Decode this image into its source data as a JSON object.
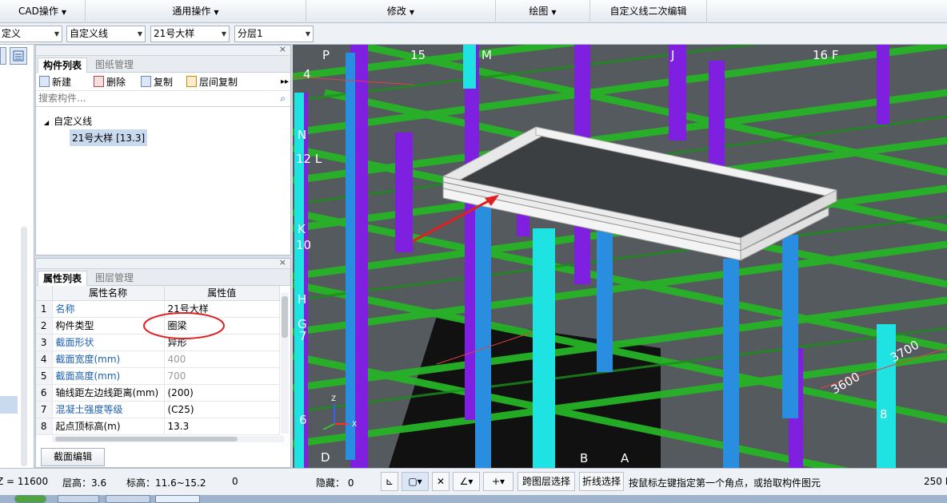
{
  "menubar": {
    "items": [
      {
        "label": "CAD操作",
        "dropdown": true
      },
      {
        "label": "通用操作",
        "dropdown": true
      },
      {
        "label": "修改",
        "dropdown": true
      },
      {
        "label": "绘图",
        "dropdown": true
      },
      {
        "label": "自定义线二次编辑",
        "dropdown": false
      }
    ]
  },
  "toolbar": {
    "combo1": "定义",
    "combo2": "自定义线",
    "combo3": "21号大样",
    "combo4": "分层1"
  },
  "component_panel": {
    "tab_active": "构件列表",
    "tab_inactive": "图纸管理",
    "buttons": {
      "new": "新建",
      "delete": "删除",
      "copy": "复制",
      "floor_copy": "层间复制"
    },
    "search_placeholder": "搜索构件...",
    "tree_root": "自定义线",
    "tree_item": "21号大样 [13.3]"
  },
  "property_panel": {
    "tab_active": "属性列表",
    "tab_inactive": "图层管理",
    "headers": {
      "name": "属性名称",
      "value": "属性值"
    },
    "rows": [
      {
        "num": "1",
        "name": "名称",
        "value": "21号大样"
      },
      {
        "num": "2",
        "name": "构件类型",
        "value": "圈梁"
      },
      {
        "num": "3",
        "name": "截面形状",
        "value": "异形"
      },
      {
        "num": "4",
        "name": "截面宽度(mm)",
        "value": "400"
      },
      {
        "num": "5",
        "name": "截面高度(mm)",
        "value": "700"
      },
      {
        "num": "6",
        "name": "轴线距左边线距离(mm)",
        "value": "(200)"
      },
      {
        "num": "7",
        "name": "混凝土强度等级",
        "value": "(C25)"
      },
      {
        "num": "8",
        "name": "起点顶标高(m)",
        "value": "13.3"
      }
    ],
    "section_edit_button": "截面编辑"
  },
  "viewport": {
    "axis_labels": {
      "a15": "15",
      "M": "M",
      "J": "J",
      "a16F": "16 F",
      "a4": "4",
      "N": "N",
      "a12L": "12 L",
      "K": "K",
      "a10": "10",
      "H": "H",
      "G": "G",
      "a7": "7",
      "a6": "6",
      "D": "D",
      "B": "B",
      "A": "A",
      "a8": "8",
      "P": "P"
    },
    "dims": {
      "d1": "3600",
      "d2": "3700"
    }
  },
  "statusbar": {
    "z": "Z = 11600",
    "floor_height": "层高：3.6",
    "elevation": "标高：11.6~15.2",
    "zero": "0",
    "hidden": "隐藏：  0",
    "cross_layer": "跨图层选择",
    "polyline_select": "折线选择",
    "hint": "按鼠标左键指定第一个角点，或拾取构件图元",
    "fps": "250 F"
  }
}
